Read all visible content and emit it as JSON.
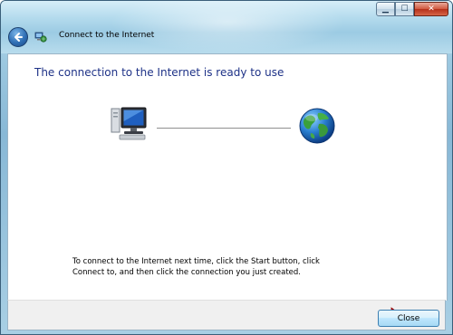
{
  "window": {
    "title": "Connect to the Internet",
    "controls": [
      "minimize",
      "maximize",
      "close"
    ]
  },
  "main": {
    "heading": "The connection to the Internet is ready to use",
    "instructions": "To connect to the Internet next time, click the Start button, click Connect to, and then click the connection you just created."
  },
  "footer": {
    "close_label": "Close"
  },
  "colors": {
    "heading": "#1e3287",
    "arrow": "#e00000"
  }
}
